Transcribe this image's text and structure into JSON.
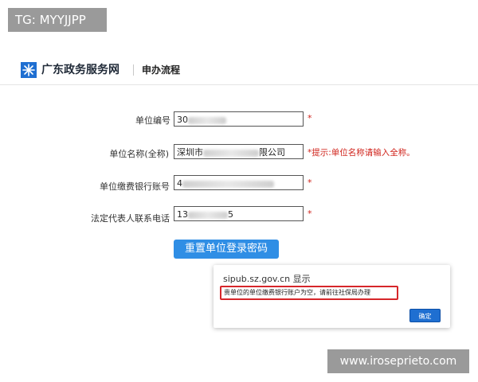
{
  "watermark_top": "TG: MYYJJPP",
  "watermark_bottom": "www.iroseprieto.com",
  "header": {
    "site_title": "广东政务服务网",
    "subtitle": "申办流程",
    "logo_icon": "snowflake-logo-icon",
    "accent": "#1f6fd1"
  },
  "form": {
    "unit_code": {
      "label": "单位编号",
      "value": "30",
      "required_mark": "*"
    },
    "unit_name": {
      "label": "单位名称(全称)",
      "value_prefix": "深圳市",
      "value_suffix": "限公司",
      "hint": "*提示:单位名称请输入全称。"
    },
    "bank_account": {
      "label": "单位缴费银行账号",
      "value": "4",
      "required_mark": "*"
    },
    "legal_phone": {
      "label": "法定代表人联系电话",
      "value_prefix": "13",
      "value_suffix": "5",
      "required_mark": "*"
    }
  },
  "reset_button": {
    "label": "重置单位登录密码",
    "color": "#2f8ee5"
  },
  "dialog": {
    "title": "sipub.sz.gov.cn 显示",
    "message": "贵单位的单位缴费银行账户为空，请前往社保局办理",
    "ok_label": "确定",
    "highlight_color": "#d6262a"
  }
}
